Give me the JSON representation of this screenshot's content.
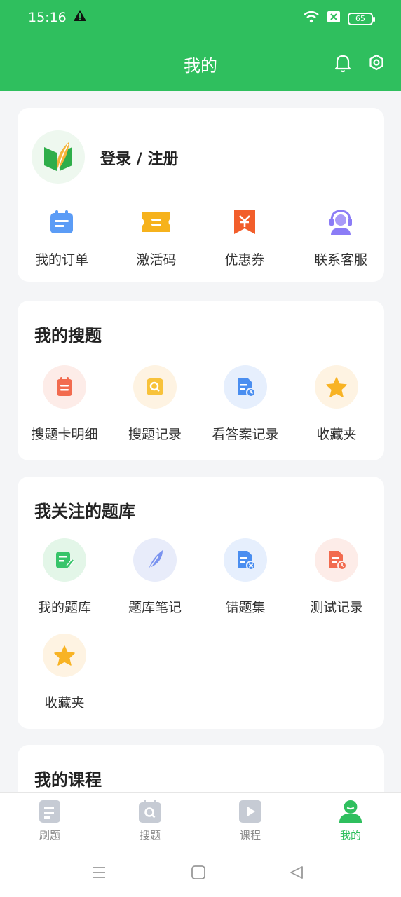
{
  "status_bar": {
    "time": "15:16",
    "battery": "65"
  },
  "header": {
    "title": "我的"
  },
  "account": {
    "login_label": "登录 / 注册",
    "shortcuts": [
      {
        "label": "我的订单",
        "icon": "calendar-icon"
      },
      {
        "label": "激活码",
        "icon": "ticket-icon"
      },
      {
        "label": "优惠券",
        "icon": "coupon-icon"
      },
      {
        "label": "联系客服",
        "icon": "headset-icon"
      }
    ]
  },
  "my_search": {
    "title": "我的搜题",
    "items": [
      {
        "label": "搜题卡明细",
        "icon": "notepad-icon"
      },
      {
        "label": "搜题记录",
        "icon": "search-icon"
      },
      {
        "label": "看答案记录",
        "icon": "document-clock-icon"
      },
      {
        "label": "收藏夹",
        "icon": "star-icon"
      }
    ]
  },
  "followed_banks": {
    "title": "我关注的题库",
    "items": [
      {
        "label": "我的题库",
        "icon": "edit-note-icon"
      },
      {
        "label": "题库笔记",
        "icon": "feather-icon"
      },
      {
        "label": "错题集",
        "icon": "document-x-icon"
      },
      {
        "label": "测试记录",
        "icon": "document-clock-icon"
      },
      {
        "label": "收藏夹",
        "icon": "star-icon"
      }
    ]
  },
  "my_courses": {
    "title": "我的课程"
  },
  "tabs": [
    {
      "label": "刷题",
      "icon": "document-icon"
    },
    {
      "label": "搜题",
      "icon": "search-icon"
    },
    {
      "label": "课程",
      "icon": "play-icon"
    },
    {
      "label": "我的",
      "icon": "person-icon"
    }
  ],
  "colors": {
    "brand": "#2fbf5e",
    "background": "#f4f5f7"
  }
}
